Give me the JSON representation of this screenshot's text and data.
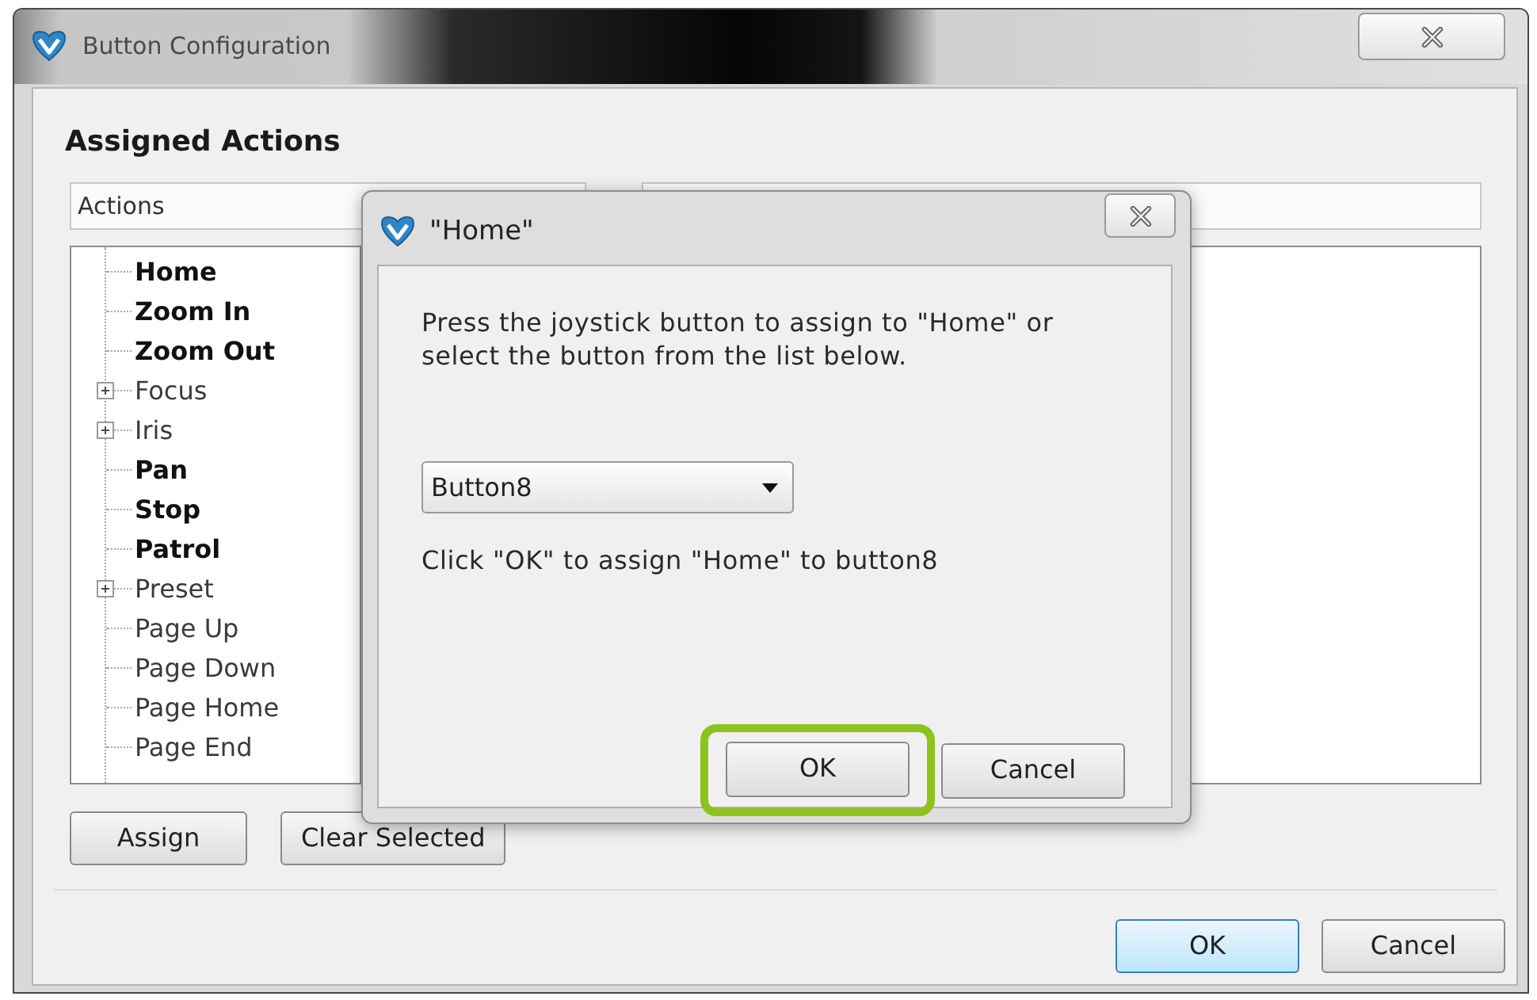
{
  "main_window": {
    "title": "Button Configuration",
    "section_title": "Assigned Actions",
    "columns": [
      "Actions"
    ],
    "actions_tree": [
      {
        "label": "Home",
        "kind": "action",
        "assigned": true
      },
      {
        "label": "Zoom In",
        "kind": "action",
        "assigned": true
      },
      {
        "label": "Zoom Out",
        "kind": "action",
        "assigned": true
      },
      {
        "label": "Focus",
        "kind": "group",
        "assigned": false
      },
      {
        "label": "Iris",
        "kind": "group",
        "assigned": false
      },
      {
        "label": "Pan",
        "kind": "action",
        "assigned": true
      },
      {
        "label": "Stop",
        "kind": "action",
        "assigned": true
      },
      {
        "label": "Patrol",
        "kind": "action",
        "assigned": true
      },
      {
        "label": "Preset",
        "kind": "group",
        "assigned": false
      },
      {
        "label": "Page Up",
        "kind": "action",
        "assigned": false
      },
      {
        "label": "Page Down",
        "kind": "action",
        "assigned": false
      },
      {
        "label": "Page Home",
        "kind": "action",
        "assigned": false
      },
      {
        "label": "Page End",
        "kind": "action",
        "assigned": false
      }
    ],
    "buttons": [
      {
        "label": "Assign"
      },
      {
        "label": "Clear Selected"
      }
    ],
    "footer_buttons": [
      {
        "label": "OK",
        "default": true
      },
      {
        "label": "Cancel",
        "default": false
      }
    ]
  },
  "dialog": {
    "title": "\"Home\"",
    "message": "Press the joystick button to assign to \"Home\" or select the button from the list below.",
    "dropdown": {
      "value": "Button8"
    },
    "confirmation": "Click \"OK\" to assign \"Home\" to button8",
    "buttons": [
      {
        "label": "OK",
        "highlighted": true
      },
      {
        "label": "Cancel",
        "highlighted": false
      }
    ]
  }
}
